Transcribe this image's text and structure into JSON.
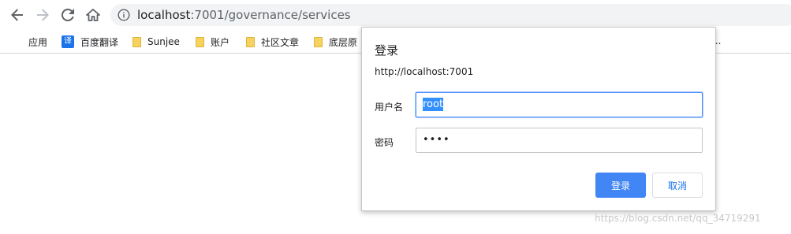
{
  "browser": {
    "url_host": "localhost",
    "url_path": ":7001/governance/services",
    "icons": [
      "back-icon",
      "forward-icon",
      "reload-icon",
      "home-icon",
      "info-icon"
    ]
  },
  "bookmarks": {
    "apps_label": "应用",
    "items": [
      {
        "label": "百度翻译",
        "icon": "translate-icon"
      },
      {
        "label": "Sunjee",
        "icon": "folder-icon"
      },
      {
        "label": "账户",
        "icon": "folder-icon"
      },
      {
        "label": "社区文章",
        "icon": "folder-icon"
      },
      {
        "label": "底层原",
        "icon": "folder-icon"
      }
    ],
    "overflow": "..."
  },
  "dialog": {
    "title": "登录",
    "origin": "http://localhost:7001",
    "username_label": "用户名",
    "username_value": "root",
    "password_label": "密码",
    "password_value": "••••",
    "submit_label": "登录",
    "cancel_label": "取消"
  },
  "watermark": "https://blog.csdn.net/qq_34719291",
  "colors": {
    "primary": "#4285f4",
    "selection": "#3390ff",
    "focus": "#4d90fe"
  }
}
